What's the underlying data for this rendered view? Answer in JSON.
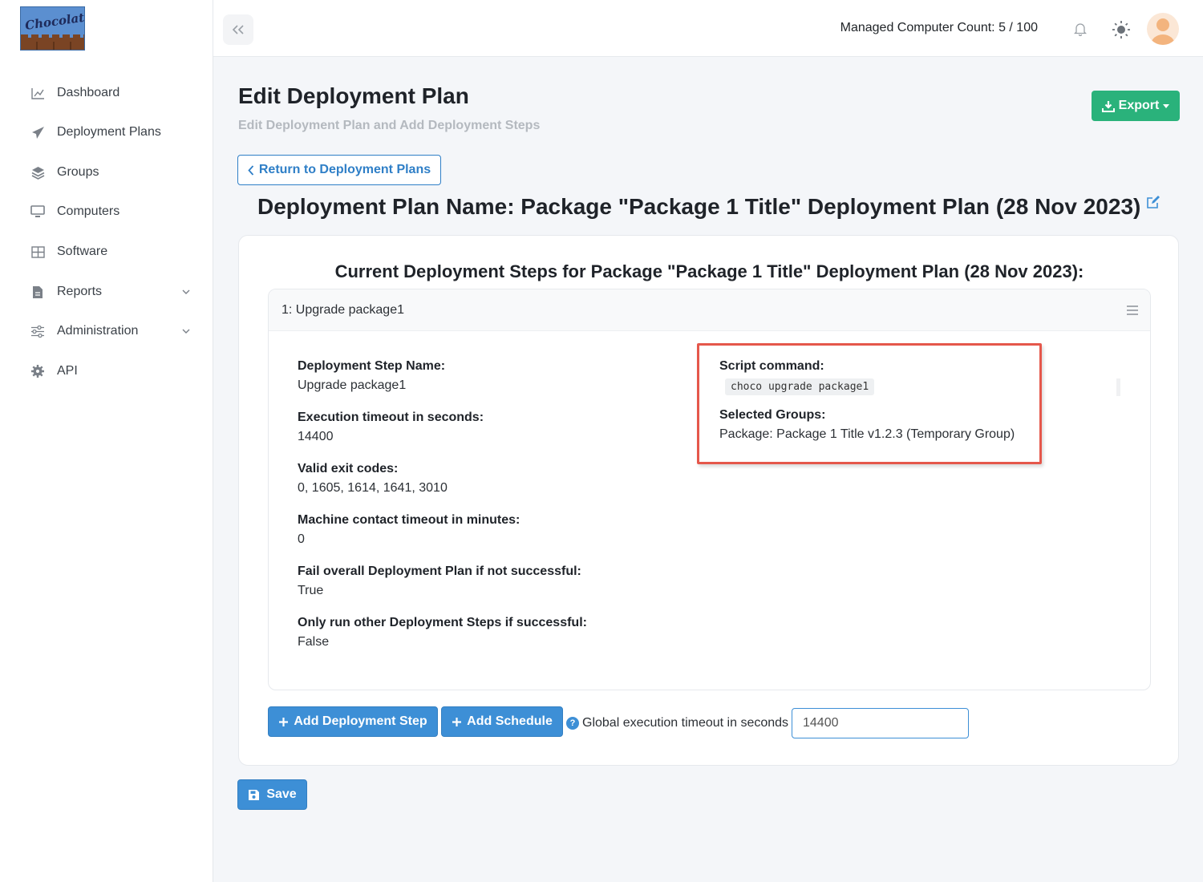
{
  "app": {
    "logo_text": "Chocolatey"
  },
  "sidebar": {
    "items": [
      {
        "label": "Dashboard",
        "icon": "chart-line-icon"
      },
      {
        "label": "Deployment Plans",
        "icon": "paper-plane-icon"
      },
      {
        "label": "Groups",
        "icon": "layers-icon"
      },
      {
        "label": "Computers",
        "icon": "monitor-icon"
      },
      {
        "label": "Software",
        "icon": "grid-icon"
      },
      {
        "label": "Reports",
        "icon": "file-icon",
        "expandable": true
      },
      {
        "label": "Administration",
        "icon": "sliders-icon",
        "expandable": true
      },
      {
        "label": "API",
        "icon": "gear-icon"
      }
    ]
  },
  "header": {
    "managed_count": "Managed Computer Count: 5 / 100"
  },
  "page": {
    "title": "Edit Deployment Plan",
    "subtitle": "Edit Deployment Plan and Add Deployment Steps",
    "export_label": "Export",
    "return_label": "Return to Deployment Plans",
    "plan_name": "Deployment Plan Name: Package \"Package 1 Title\" Deployment Plan (28 Nov 2023)"
  },
  "steps_card": {
    "title": "Current Deployment Steps for Package \"Package 1 Title\" Deployment Plan (28 Nov 2023):",
    "step": {
      "header": "1: Upgrade package1",
      "fields": [
        {
          "label": "Deployment Step Name:",
          "value": "Upgrade package1"
        },
        {
          "label": "Execution timeout in seconds:",
          "value": "14400"
        },
        {
          "label": "Valid exit codes:",
          "value": "0, 1605, 1614, 1641, 3010"
        },
        {
          "label": "Machine contact timeout in minutes:",
          "value": "0"
        },
        {
          "label": "Fail overall Deployment Plan if not successful:",
          "value": "True"
        },
        {
          "label": "Only run other Deployment Steps if successful:",
          "value": "False"
        }
      ],
      "script_label": "Script command:",
      "script_value": "choco upgrade package1",
      "groups_label": "Selected Groups:",
      "groups_value": "Package: Package 1 Title v1.2.3 (Temporary Group)"
    },
    "add_step_label": "Add Deployment Step",
    "add_schedule_label": "Add Schedule",
    "global_timeout_label": "Global execution timeout in seconds",
    "global_timeout_value": "14400"
  },
  "save_label": "Save",
  "colors": {
    "primary": "#3d8fd6",
    "success": "#2ab27b",
    "highlight": "#e5574b"
  }
}
